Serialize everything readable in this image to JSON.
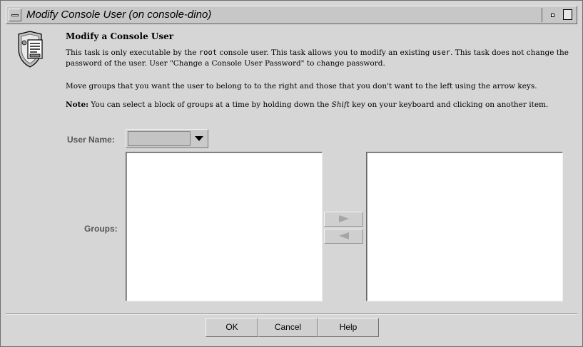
{
  "window": {
    "title": "Modify Console User (on console-dino)"
  },
  "task": {
    "heading": "Modify a Console User",
    "p1_a": "This task is only executable by the ",
    "p1_kw": "root",
    "p1_b": " console user. This task allows you to modify an existing ",
    "p1_kw2": "user",
    "p1_c": ". This task does not change the password of the user. User \"Change a Console User Password\" to change password.",
    "p2": "Move groups that you want the user to belong to to the right and those that you don't want to the left using the arrow keys.",
    "p3_label": "Note:",
    "p3_a": "  You can select a block of groups at a time by holding down the ",
    "p3_key": "Shift",
    "p3_b": " key on your keyboard and clicking on another item."
  },
  "form": {
    "user_name_label": "User Name:",
    "user_name_value": "",
    "groups_label": "Groups:",
    "available_groups": [],
    "selected_groups": []
  },
  "buttons": {
    "ok": "OK",
    "cancel": "Cancel",
    "help": "Help"
  },
  "icons": {
    "window_menu": "window-menu-icon",
    "minimize": "minimize-icon",
    "maximize": "maximize-icon",
    "task": "console-user-shield-icon",
    "move_right": "arrow-right-icon",
    "move_left": "arrow-left-icon",
    "dropdown": "chevron-down-icon"
  },
  "colors": {
    "window_bg": "#d6d6d6",
    "list_bg": "#ffffff",
    "label_text": "#555555"
  }
}
